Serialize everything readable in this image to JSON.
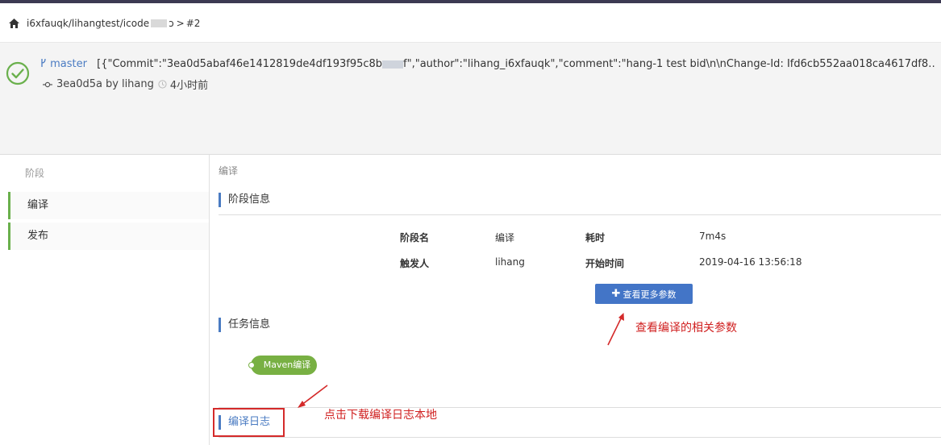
{
  "breadcrumb": {
    "path_prefix": "i6xfauqk/lihangtest/icode",
    "path_suffix": "ɔ",
    "separator": ">",
    "build": "#2"
  },
  "build": {
    "status": "success",
    "branch": "master",
    "commit_message_start": "[{\"Commit\":\"3ea0d5abaf46e1412819de4df193f95c8b",
    "commit_message_end": "f\",\"author\":\"lihang_i6xfauqk\",\"comment\":\"hang-1 test bid\\n\\nChange-Id: Ifd6cb552aa018ca4617df8…",
    "commit_hash": "3ea0d5a",
    "by_text": "by",
    "author": "lihang",
    "time_ago": "4小时前"
  },
  "sidebar": {
    "heading": "阶段",
    "items": [
      {
        "label": "编译",
        "active": true
      },
      {
        "label": "发布",
        "active": false
      }
    ]
  },
  "main": {
    "crumb": "编译",
    "stage_info": {
      "title": "阶段信息",
      "rows": [
        {
          "k1": "阶段名",
          "v1": "编译",
          "k2": "耗时",
          "v2": "7m4s"
        },
        {
          "k1": "触发人",
          "v1": "lihang",
          "k2": "开始时间",
          "v2": "2019-04-16 13:56:18"
        }
      ],
      "more_button": "查看更多参数"
    },
    "task_info": {
      "title": "任务信息",
      "tasks": [
        "Maven编译"
      ]
    },
    "log": {
      "title": "编译日志"
    }
  },
  "annotations": {
    "params_note": "查看编译的相关参数",
    "download_note": "点击下载编译日志本地"
  },
  "colors": {
    "accent_blue": "#4375c7",
    "success_green": "#6ab04c",
    "task_green": "#78b043",
    "annotation_red": "#d02020",
    "topbar": "#3c3a52"
  }
}
